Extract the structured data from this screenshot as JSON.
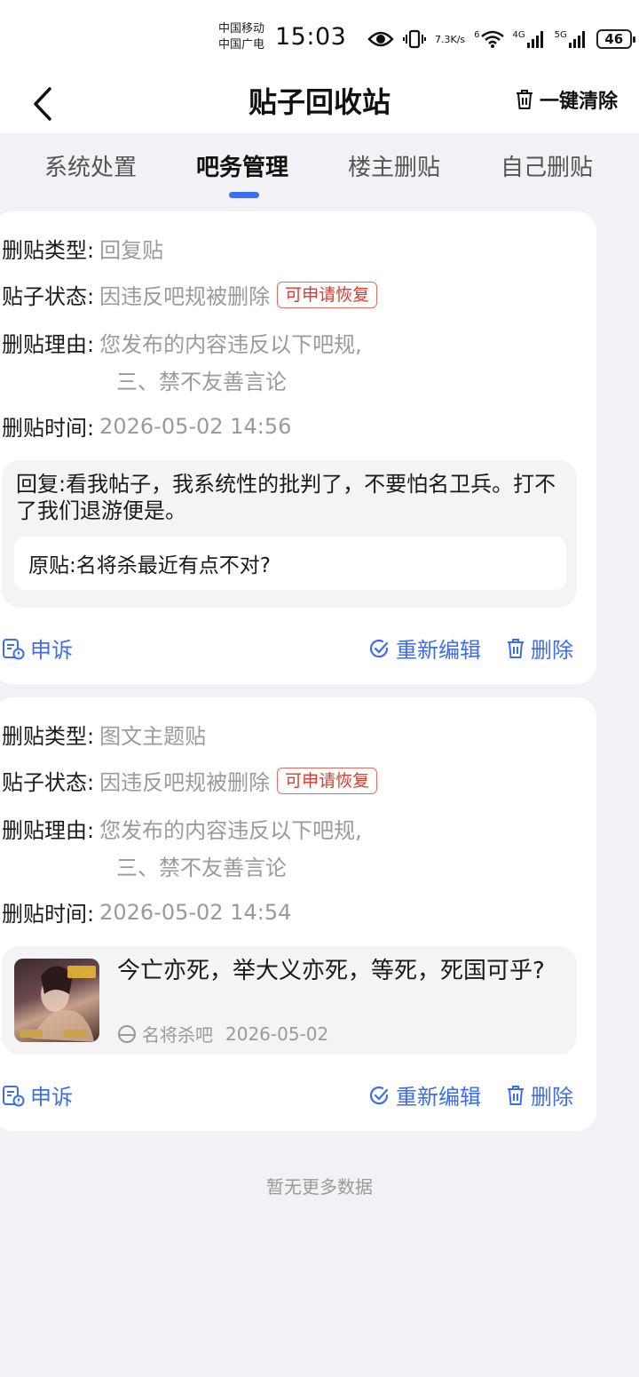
{
  "status_bar": {
    "carrier_1": "中国移动",
    "carrier_2": "中国广电",
    "time": "15:03",
    "net_speed_value": "7.3",
    "net_speed_unit": "K/s",
    "wifi_label": "6",
    "signal_1_label": "4G",
    "signal_2_label": "5G",
    "battery": "46"
  },
  "header": {
    "title": "贴子回收站",
    "clear_label": "一键清除"
  },
  "tabs": [
    {
      "label": "系统处置"
    },
    {
      "label": "吧务管理"
    },
    {
      "label": "楼主删贴"
    },
    {
      "label": "自己删贴"
    }
  ],
  "active_tab": "吧务管理",
  "labels": {
    "type": "删贴类型:",
    "status": "贴子状态:",
    "reason": "删贴理由:",
    "time": "删贴时间:"
  },
  "actions": {
    "appeal": "申诉",
    "reedit": "重新编辑",
    "delete": "删除"
  },
  "posts": [
    {
      "type": "回复贴",
      "status": "因违反吧规被删除",
      "badge": "可申请恢复",
      "reason_line1": "您发布的内容违反以下吧规,",
      "reason_line2": "三、禁不友善言论",
      "time": "2026-05-02 14:56",
      "reply": "回复:看我帖子，我系统性的批判了，不要怕名卫兵。打不了我们退游便是。",
      "origin": "原贴:名将杀最近有点不对?"
    },
    {
      "type": "图文主题贴",
      "status": "因违反吧规被删除",
      "badge": "可申请恢复",
      "reason_line1": "您发布的内容违反以下吧规,",
      "reason_line2": "三、禁不友善言论",
      "time": "2026-05-02 14:54",
      "thread_title": "今亡亦死，举大义亦死，等死，死国可乎?",
      "forum": "名将杀吧",
      "date": "2026-05-02"
    }
  ],
  "footer": "暂无更多数据",
  "colors": {
    "accent": "#3d6cf0",
    "badge_red": "#e0392b",
    "background": "#f2f2f6"
  }
}
